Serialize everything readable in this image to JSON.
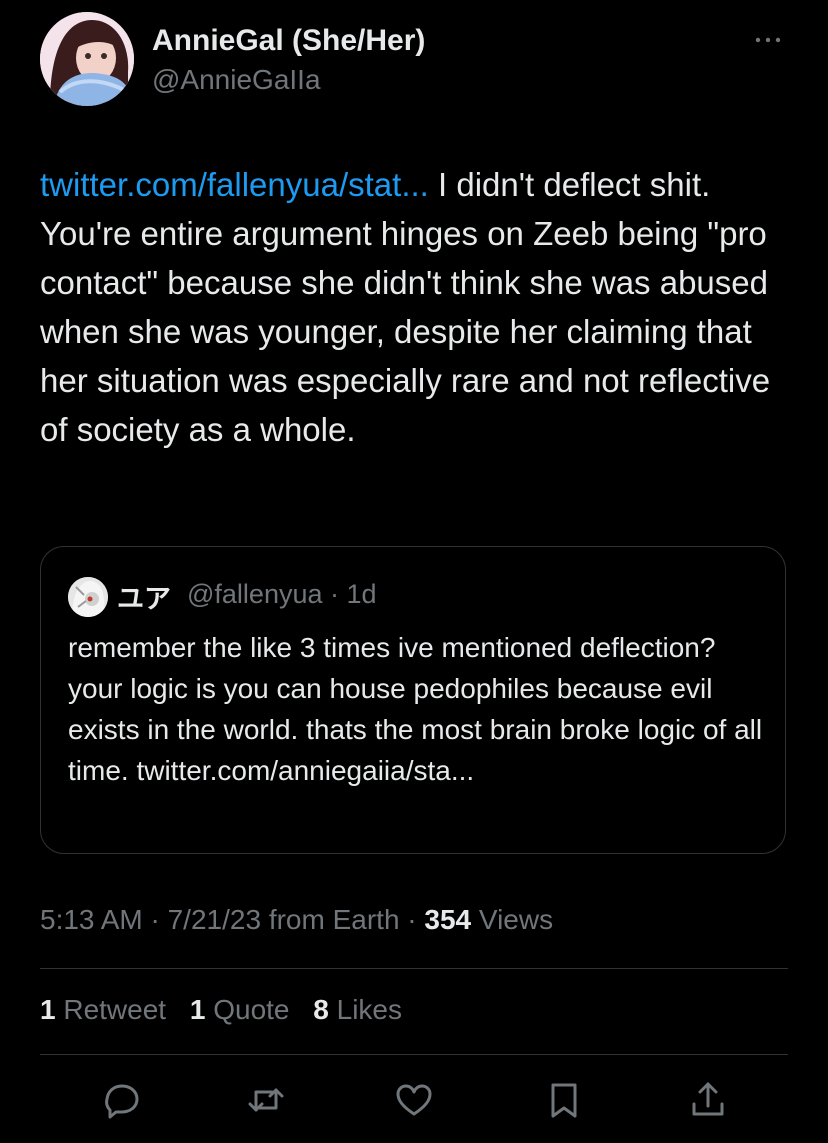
{
  "author": {
    "display_name": "AnnieGal (She/Her)",
    "handle": "@AnnieGaIIa"
  },
  "tweet": {
    "link_text": "twitter.com/fallenyua/stat...",
    "text": " I didn't deflect shit. You're entire argument hinges on Zeeb being \"pro contact\" because she didn't think she was abused when she was younger, despite her claiming that her situation was especially rare and not reflective of society as a whole."
  },
  "quote": {
    "name": "ユア",
    "meta": "@fallenyua · 1d",
    "text": "remember the like 3 times ive mentioned deflection? your logic is you can house pedophiles because evil exists in the world. thats the most brain broke logic of all time. twitter.com/anniegaiia/sta..."
  },
  "meta": {
    "time": "5:13 AM · 7/21/23 from Earth · ",
    "views_count": "354",
    "views_label": " Views"
  },
  "stats": {
    "retweets_count": "1",
    "retweets_label": "Retweet",
    "quotes_count": "1",
    "quotes_label": "Quote",
    "likes_count": "8",
    "likes_label": "Likes"
  },
  "icons": {
    "more": "more-icon",
    "reply": "reply-icon",
    "retweet": "retweet-icon",
    "like": "like-icon",
    "bookmark": "bookmark-icon",
    "share": "share-icon"
  },
  "colors": {
    "background": "#000000",
    "text": "#e7e9ea",
    "secondary": "#71767b",
    "link": "#1d9bf0",
    "border": "#2f3336"
  }
}
